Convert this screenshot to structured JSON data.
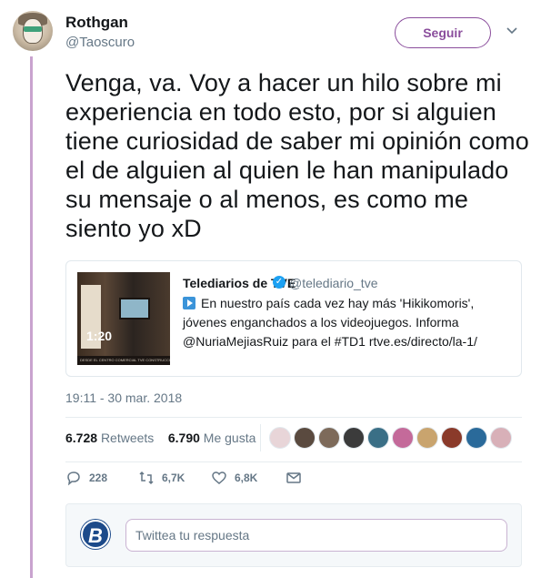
{
  "author": {
    "display_name": "Rothgan",
    "handle": "@Taoscuro"
  },
  "header": {
    "follow_label": "Seguir"
  },
  "tweet": {
    "text": "Venga, va. Voy a hacer un hilo sobre mi experiencia en todo esto, por si alguien tiene curiosidad de saber mi opinión como el de alguien al quien le han manipulado su mensaje o al menos, es como me siento yo xD",
    "timestamp": "19:11 - 30 mar. 2018"
  },
  "quoted_card": {
    "name": "Telediarios de TVE",
    "handle": "@telediario_tve",
    "verified": true,
    "text": "En nuestro país cada vez hay más 'Hikikomoris', jóvenes enganchados a los videojuegos. Informa @NuriaMejiasRuiz para el #TD1 rtve.es/directo/la-1/",
    "video_duration": "1:20",
    "thumb_caption": "DESDE EL CENTRO COMERCIAL TVE CONSTRUCCION"
  },
  "stats": {
    "retweets_count": "6.728",
    "retweets_label": "Retweets",
    "likes_count": "6.790",
    "likes_label": "Me gusta"
  },
  "likers": [
    "#e8d5d8",
    "#5a4a3f",
    "#7d6a5a",
    "#3b3b3b",
    "#3a6f86",
    "#c46a9a",
    "#c9a46e",
    "#8a3a2a",
    "#2a6a9a",
    "#d8b0b8"
  ],
  "actions": {
    "reply_count": "228",
    "retweet_count": "6,7K",
    "like_count": "6,8K"
  },
  "reply": {
    "placeholder": "Twittea tu respuesta",
    "avatar_letter": "B"
  },
  "colors": {
    "accent": "#8a4d9c",
    "thread_line": "#c9a3cf",
    "verified": "#1da1f2"
  }
}
